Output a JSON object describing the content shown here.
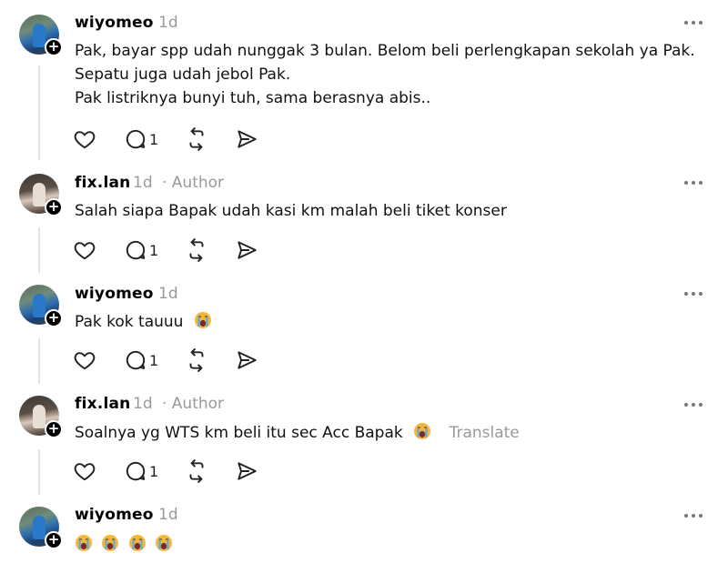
{
  "posts": [
    {
      "username": "wiyomeo",
      "time": "1d",
      "author_tag": "",
      "lines": [
        "Pak, bayar spp udah nunggak 3 bulan. Belom beli perlengkapan sekolah ya Pak.",
        "Sepatu juga udah jebol Pak.",
        "Pak listriknya bunyi tuh, sama berasnya abis.."
      ],
      "reply_count": "1"
    },
    {
      "username": "fix.lan",
      "time": "1d",
      "author_tag": "· Author",
      "lines": [
        "Salah siapa Bapak udah kasi km malah beli tiket konser"
      ],
      "reply_count": "1"
    },
    {
      "username": "wiyomeo",
      "time": "1d",
      "author_tag": "",
      "lines": [
        "Pak kok tauuu"
      ],
      "emoji": "crying-face",
      "reply_count": "1"
    },
    {
      "username": "fix.lan",
      "time": "1d",
      "author_tag": "· Author",
      "lines": [
        "Soalnya yg WTS km beli itu sec Acc Bapak"
      ],
      "emoji": "crying-face",
      "translate": "Translate",
      "reply_count": "1"
    },
    {
      "username": "wiyomeo",
      "time": "1d",
      "author_tag": "",
      "emoji_row": [
        "crying-face",
        "crying-face",
        "crying-face",
        "crying-face"
      ]
    }
  ],
  "icons": {
    "like": "heart-icon",
    "reply": "comment-icon",
    "repost": "repost-icon",
    "share": "send-icon",
    "more": "more-icon"
  },
  "colors": {
    "muted": "#9a9a9a",
    "thread_line": "#e3e3e3",
    "text": "#111111"
  }
}
